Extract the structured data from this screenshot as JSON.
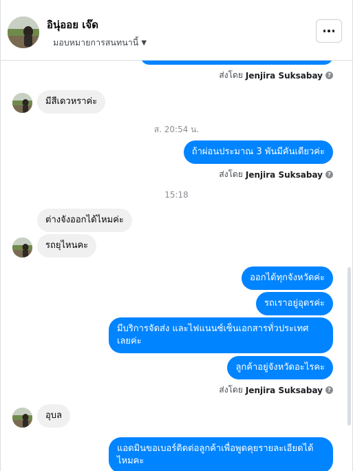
{
  "header": {
    "contact_name": "อินุ่ออย เจ๊ด",
    "assign_label": "มอบหมายการสนทนานี้",
    "caret": "▼",
    "more_icon": "more-icon"
  },
  "sent_by": {
    "prefix": "ส่งโดย",
    "name": "Jenjira Suksabay",
    "help": "?"
  },
  "messages": [
    {
      "side": "in",
      "text": "มีสีเดวหราค่ะ"
    },
    {
      "side": "out",
      "text": "ถ้าผ่อนประมาณ 3 พันมีคันเดียวค่ะ"
    },
    {
      "side": "in",
      "text": "ต่างจังออกได้ไหมค่ะ"
    },
    {
      "side": "in",
      "text": "รถยุไหนคะ"
    },
    {
      "side": "out",
      "text": "ออกได้ทุกจังหวัดค่ะ"
    },
    {
      "side": "out",
      "text": "รถเราอยู่อุดรค่ะ"
    },
    {
      "side": "out",
      "text": "มีบริการจัดส่ง และไฟแนนซ์เซ็นเอกสารทั่วประเทศ เลยค่ะ"
    },
    {
      "side": "out",
      "text": "ลูกค้าอยู่จังหวัดอะไรคะ"
    },
    {
      "side": "in",
      "text": "อุบล"
    },
    {
      "side": "out",
      "text": "แอดมินขอเบอร์ติดต่อลูกค้าเพื่อพูดคุยรายละเอียดได้ไหมคะ"
    }
  ],
  "timestamps": {
    "first": "ส. 20:54 น.",
    "second": "15:18"
  },
  "colors": {
    "outgoing": "#0084ff",
    "incoming": "#f0f0f0"
  }
}
